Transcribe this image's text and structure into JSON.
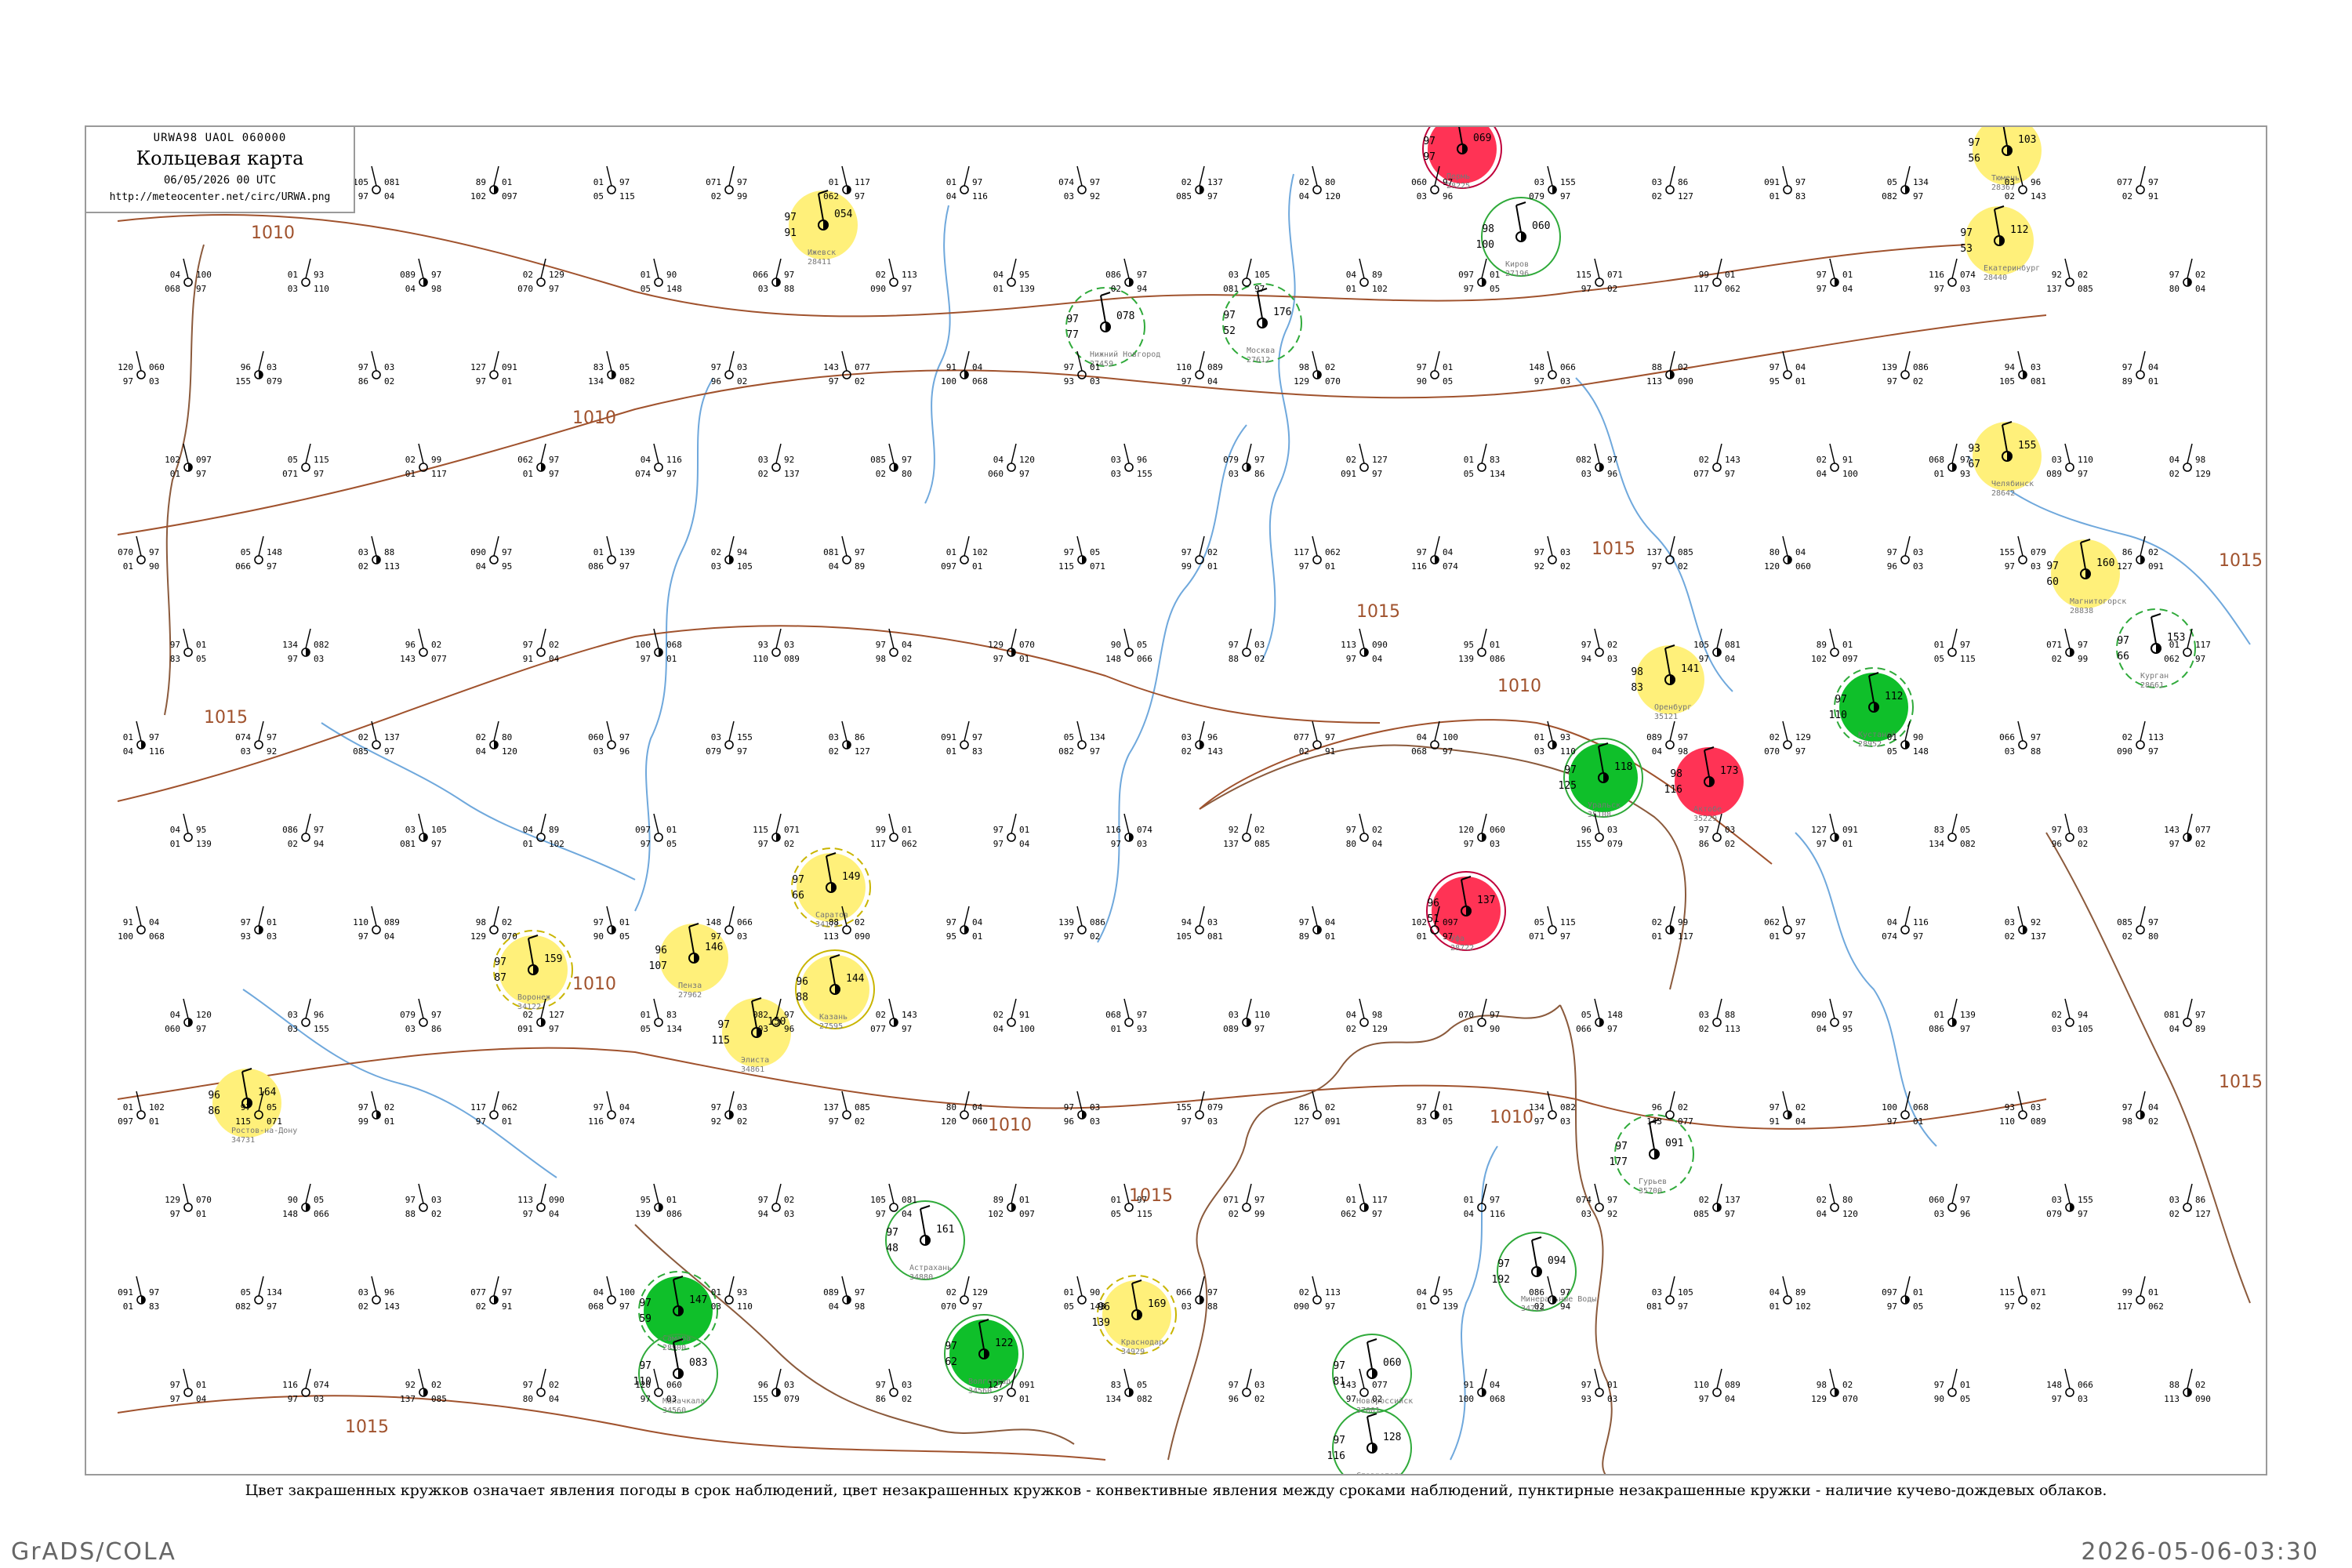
{
  "header": {
    "code_line": "URWA98  UAOL  060000",
    "title": "Кольцевая карта",
    "date_line": "06/05/2026 00 UTC",
    "url": "http://meteocenter.net/circ/URWA.png"
  },
  "legend_note": "Цвет закрашенных кружков означает явления погоды в срок наблюдений, цвет незакрашенных кружков - конвективные явления между сроками наблюдений, пунктирные незакрашенные кружки - наличие кучево-дождевых облаков.",
  "footer": {
    "left": "GrADS/COLA",
    "right": "2026-05-06-03:30"
  },
  "colors": {
    "frame": "#9a9a9a",
    "isobar": "#a0522d",
    "rivers": "#6fa8dc",
    "highlight_green": "#00c020",
    "highlight_yellow": "#fff07a",
    "highlight_red": "#ff3355",
    "thunder_ring": "#33aa33"
  },
  "isobar_labels": [
    "1010",
    "1010",
    "1015",
    "1015",
    "1010",
    "1015",
    "1015",
    "1010",
    "1010",
    "1015",
    "1015",
    "1015",
    "1010"
  ],
  "stations": [
    {
      "name": "Волгоград",
      "id": "34560",
      "p": "122",
      "t": "97",
      "td": "62",
      "fill": "green",
      "ring": "solid"
    },
    {
      "name": "Самара",
      "id": "28900",
      "p": "147",
      "t": "97",
      "td": "59",
      "fill": "green",
      "ring": "dashed"
    },
    {
      "name": "Пермь",
      "id": "28225",
      "p": "069",
      "t": "97",
      "td": "97",
      "fill": "red",
      "ring": "solid"
    },
    {
      "name": "Уфа",
      "id": "28722",
      "p": "137",
      "t": "96",
      "td": "51",
      "fill": "red",
      "ring": "solid"
    },
    {
      "name": "Оренбург",
      "id": "35121",
      "p": "141",
      "t": "98",
      "td": "83",
      "fill": "yellow",
      "ring": "none"
    },
    {
      "name": "Казань",
      "id": "27595",
      "p": "144",
      "t": "96",
      "td": "88",
      "fill": "yellow",
      "ring": "solid"
    },
    {
      "name": "Москва",
      "id": "27612",
      "p": "176",
      "t": "97",
      "td": "52",
      "fill": "none",
      "ring": "dashed"
    },
    {
      "name": "Саратов",
      "id": "34171",
      "p": "149",
      "t": "97",
      "td": "66",
      "fill": "yellow",
      "ring": "dashed"
    },
    {
      "name": "Ростов-на-Дону",
      "id": "34731",
      "p": "164",
      "t": "96",
      "td": "86",
      "fill": "yellow",
      "ring": "none"
    },
    {
      "name": "Астрахань",
      "id": "34880",
      "p": "161",
      "t": "97",
      "td": "48",
      "fill": "none",
      "ring": "solid"
    },
    {
      "name": "Челябинск",
      "id": "28642",
      "p": "155",
      "t": "93",
      "td": "67",
      "fill": "yellow",
      "ring": "none"
    },
    {
      "name": "Екатеринбург",
      "id": "28440",
      "p": "112",
      "t": "97",
      "td": "53",
      "fill": "yellow",
      "ring": "none"
    },
    {
      "name": "Киров",
      "id": "27196",
      "p": "060",
      "t": "98",
      "td": "100",
      "fill": "none",
      "ring": "solid"
    },
    {
      "name": "Нижний Новгород",
      "id": "27459",
      "p": "078",
      "t": "97",
      "td": "77",
      "fill": "none",
      "ring": "dashed"
    },
    {
      "name": "Ижевск",
      "id": "28411",
      "p": "054",
      "t": "97",
      "td": "91",
      "fill": "yellow",
      "ring": "none"
    },
    {
      "name": "Пенза",
      "id": "27962",
      "p": "146",
      "t": "96",
      "td": "107",
      "fill": "yellow",
      "ring": "none"
    },
    {
      "name": "Воронеж",
      "id": "34122",
      "p": "159",
      "t": "97",
      "td": "87",
      "fill": "yellow",
      "ring": "dashed"
    },
    {
      "name": "Элиста",
      "id": "34861",
      "p": "150",
      "t": "97",
      "td": "115",
      "fill": "yellow",
      "ring": "none"
    },
    {
      "name": "Краснодар",
      "id": "34929",
      "p": "169",
      "t": "96",
      "td": "139",
      "fill": "yellow",
      "ring": "dashed"
    },
    {
      "name": "Ставрополь",
      "id": "34949",
      "p": "128",
      "t": "97",
      "td": "116",
      "fill": "none",
      "ring": "solid"
    },
    {
      "name": "Махачкала",
      "id": "34560",
      "p": "083",
      "t": "97",
      "td": "110",
      "fill": "none",
      "ring": "solid"
    },
    {
      "name": "Тюмень",
      "id": "28367",
      "p": "103",
      "t": "97",
      "td": "56",
      "fill": "yellow",
      "ring": "none"
    },
    {
      "name": "Курган",
      "id": "28661",
      "p": "153",
      "t": "97",
      "td": "66",
      "fill": "none",
      "ring": "dashed"
    },
    {
      "name": "Магнитогорск",
      "id": "28838",
      "p": "160",
      "t": "97",
      "td": "60",
      "fill": "yellow",
      "ring": "none"
    },
    {
      "name": "Кустанай",
      "id": "28952",
      "p": "112",
      "t": "97",
      "td": "110",
      "fill": "green",
      "ring": "dashed"
    },
    {
      "name": "Актобе",
      "id": "35229",
      "p": "173",
      "t": "98",
      "td": "116",
      "fill": "red",
      "ring": "none"
    },
    {
      "name": "Уральск",
      "id": "35108",
      "p": "118",
      "t": "97",
      "td": "125",
      "fill": "green",
      "ring": "solid"
    },
    {
      "name": "Гурьев",
      "id": "35700",
      "p": "091",
      "t": "97",
      "td": "177",
      "fill": "none",
      "ring": "dashed"
    },
    {
      "name": "Новороссийск",
      "id": "37001",
      "p": "060",
      "t": "97",
      "td": "81",
      "fill": "none",
      "ring": "solid"
    },
    {
      "name": "Минеральные Воды",
      "id": "34712",
      "p": "094",
      "t": "97",
      "td": "192",
      "fill": "none",
      "ring": "solid"
    }
  ],
  "plain_values": [
    "105",
    "081",
    "97",
    "04",
    "89",
    "01",
    "102",
    "097",
    "01",
    "97",
    "05",
    "115",
    "071",
    "97",
    "02",
    "99",
    "01",
    "117",
    "062",
    "97",
    "01",
    "97",
    "04",
    "116",
    "074",
    "97",
    "03",
    "92",
    "02",
    "137",
    "085",
    "97",
    "02",
    "80",
    "04",
    "120",
    "060",
    "97",
    "03",
    "96",
    "03",
    "155",
    "079",
    "97",
    "03",
    "86",
    "02",
    "127",
    "091",
    "97",
    "01",
    "83",
    "05",
    "134",
    "082",
    "97",
    "03",
    "96",
    "02",
    "143",
    "077",
    "97",
    "02",
    "91",
    "04",
    "100",
    "068",
    "97",
    "01",
    "93",
    "03",
    "110",
    "089",
    "97",
    "04",
    "98",
    "02",
    "129",
    "070",
    "97",
    "01",
    "90",
    "05",
    "148",
    "066",
    "97",
    "03",
    "88",
    "02",
    "113",
    "090",
    "97",
    "04",
    "95",
    "01",
    "139",
    "086",
    "97",
    "02",
    "94",
    "03"
  ]
}
